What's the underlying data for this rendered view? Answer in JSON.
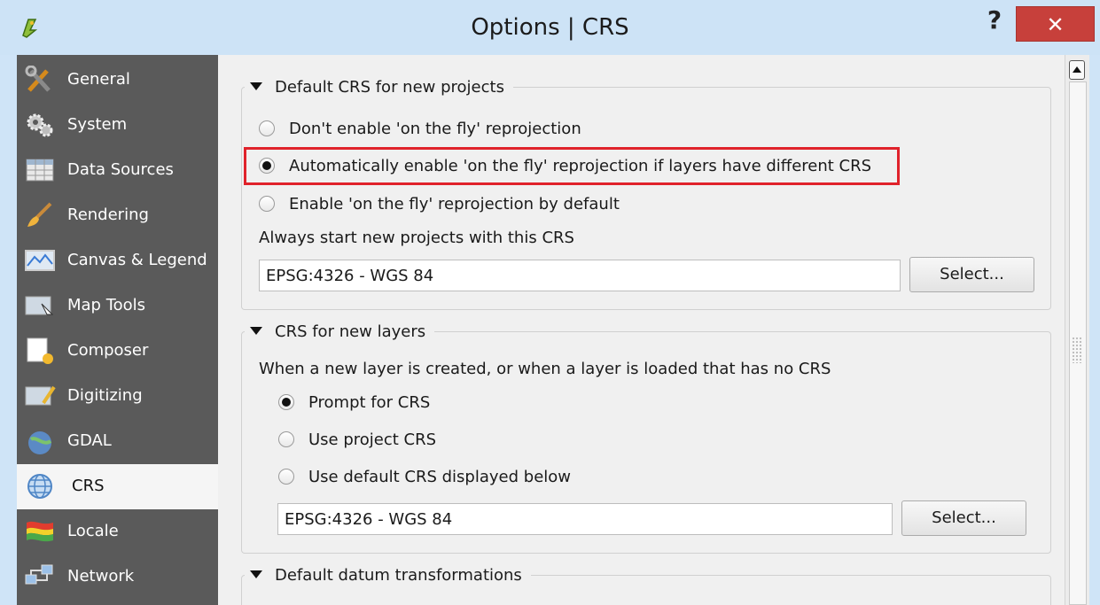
{
  "window": {
    "title": "Options | CRS",
    "help_label": "?",
    "close_label": "✕"
  },
  "sidebar": {
    "items": [
      {
        "label": "General",
        "icon": "tools-icon"
      },
      {
        "label": "System",
        "icon": "gears-icon"
      },
      {
        "label": "Data Sources",
        "icon": "table-icon"
      },
      {
        "label": "Rendering",
        "icon": "brush-icon"
      },
      {
        "label": "Canvas & Legend",
        "icon": "map-canvas-icon"
      },
      {
        "label": "Map Tools",
        "icon": "map-tools-icon"
      },
      {
        "label": "Composer",
        "icon": "composer-icon"
      },
      {
        "label": "Digitizing",
        "icon": "digitizing-icon"
      },
      {
        "label": "GDAL",
        "icon": "gdal-icon"
      },
      {
        "label": "CRS",
        "icon": "globe-icon",
        "selected": true
      },
      {
        "label": "Locale",
        "icon": "flag-icon"
      },
      {
        "label": "Network",
        "icon": "network-icon"
      }
    ]
  },
  "default_crs": {
    "legend": "Default CRS for new projects",
    "options": [
      {
        "label": "Don't enable 'on the fly' reprojection",
        "checked": false
      },
      {
        "label": "Automatically enable 'on the fly' reprojection if layers have different CRS",
        "checked": true
      },
      {
        "label": "Enable 'on the fly' reprojection by default",
        "checked": false
      }
    ],
    "always_start_label": "Always start new projects with this CRS",
    "crs_value": "EPSG:4326 - WGS 84",
    "select_label": "Select..."
  },
  "new_layers": {
    "legend": "CRS for new layers",
    "description": "When a new layer is created, or when a layer is loaded that has no CRS",
    "options": [
      {
        "label": "Prompt for CRS",
        "checked": true
      },
      {
        "label": "Use project CRS",
        "checked": false
      },
      {
        "label": "Use default CRS displayed below",
        "checked": false
      }
    ],
    "crs_value": "EPSG:4326 - WGS 84",
    "select_label": "Select..."
  },
  "datum": {
    "legend": "Default datum transformations"
  },
  "colors": {
    "highlight": "#e0222b",
    "sidebar_bg": "#5a5a5a",
    "close_bg": "#c7403b"
  }
}
